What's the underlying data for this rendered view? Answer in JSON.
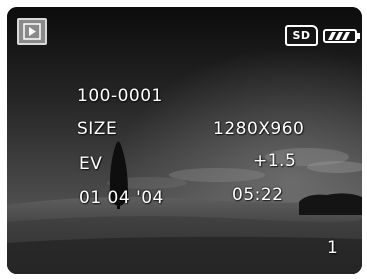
{
  "playback": {
    "file_number": "100-0001",
    "size_label": "SIZE",
    "size_value": "1280X960",
    "ev_label": "EV",
    "ev_value": "+1.5",
    "date": "01 04 '04",
    "time": "05:22",
    "frame_index": "1"
  },
  "status": {
    "mode_icon": "play-icon",
    "card_label": "SD",
    "battery_level": 1.0
  }
}
